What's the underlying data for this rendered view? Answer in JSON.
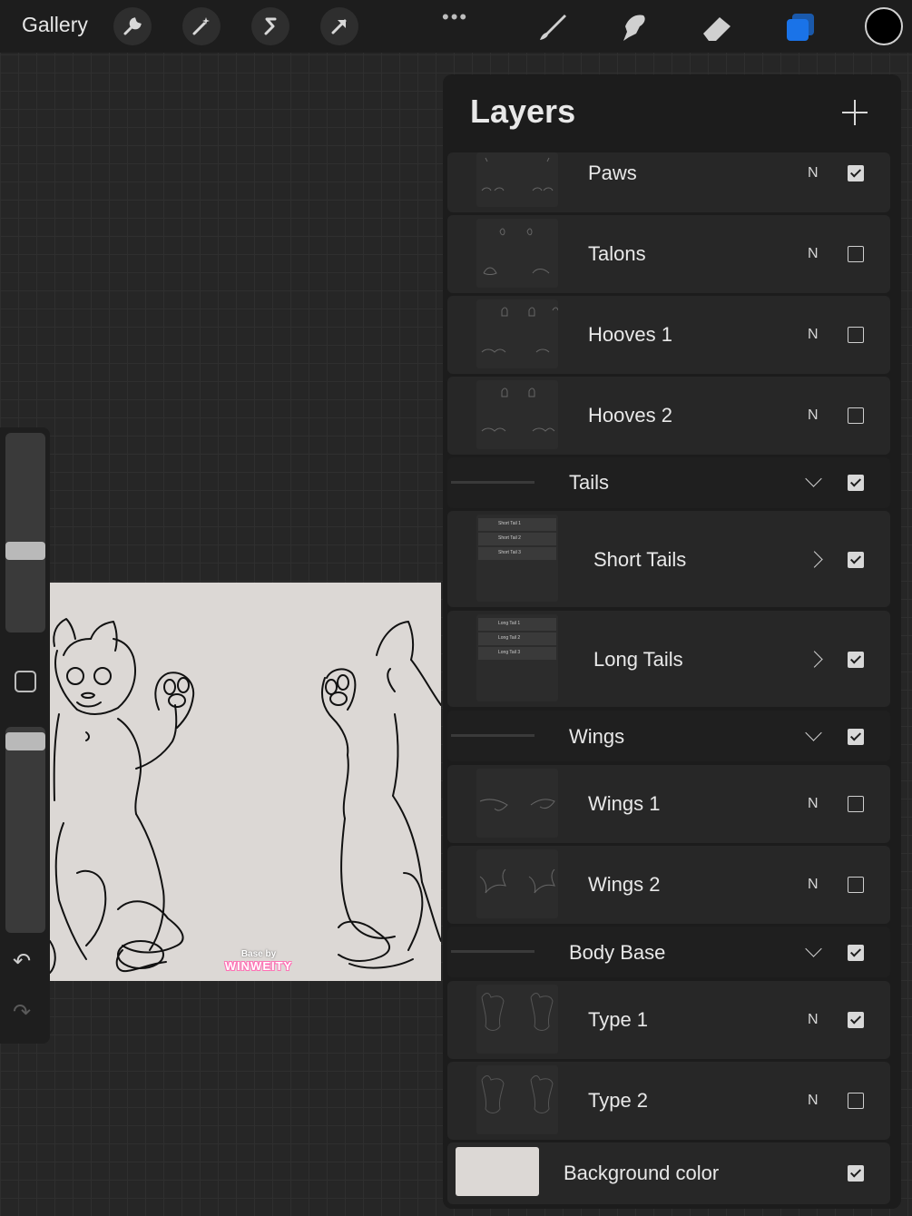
{
  "topbar": {
    "gallery_label": "Gallery",
    "left_tools": [
      "wrench-icon",
      "magic-wand-icon",
      "selection-icon",
      "transform-arrow-icon"
    ],
    "more_dots": "•••",
    "right_tools": [
      "brush-icon",
      "smudge-icon",
      "eraser-icon",
      "layers-icon"
    ],
    "active_tool_color": "#1a73e8",
    "current_color": "#000000"
  },
  "sidebar": {
    "brush_size_level": 0.55,
    "opacity_level": 0.95
  },
  "canvas": {
    "credit_prefix": "Base by",
    "credit_name": "WINWEITY"
  },
  "layers_panel": {
    "title": "Layers",
    "layers": [
      {
        "kind": "layer",
        "name": "Paws",
        "blend": "N",
        "visible": true
      },
      {
        "kind": "layer",
        "name": "Talons",
        "blend": "N",
        "visible": false
      },
      {
        "kind": "layer",
        "name": "Hooves 1",
        "blend": "N",
        "visible": false
      },
      {
        "kind": "layer",
        "name": "Hooves 2",
        "blend": "N",
        "visible": false
      },
      {
        "kind": "group",
        "name": "Tails",
        "expanded": true,
        "visible": true
      },
      {
        "kind": "subgroup",
        "name": "Short Tails",
        "visible": true,
        "mini_rows": [
          "Short Tail 1",
          "Short Tail 2",
          "Short Tail 3"
        ]
      },
      {
        "kind": "subgroup",
        "name": "Long Tails",
        "visible": true,
        "mini_rows": [
          "Long Tail 1",
          "Long Tail 2",
          "Long Tail 3"
        ]
      },
      {
        "kind": "group",
        "name": "Wings",
        "expanded": true,
        "visible": true
      },
      {
        "kind": "layer",
        "name": "Wings 1",
        "blend": "N",
        "visible": false
      },
      {
        "kind": "layer",
        "name": "Wings 2",
        "blend": "N",
        "visible": false
      },
      {
        "kind": "group",
        "name": "Body Base",
        "expanded": true,
        "visible": true
      },
      {
        "kind": "layer",
        "name": "Type 1",
        "blend": "N",
        "visible": true
      },
      {
        "kind": "layer",
        "name": "Type 2",
        "blend": "N",
        "visible": false
      },
      {
        "kind": "background",
        "name": "Background color",
        "visible": true,
        "color": "#dcd8d5"
      }
    ]
  }
}
